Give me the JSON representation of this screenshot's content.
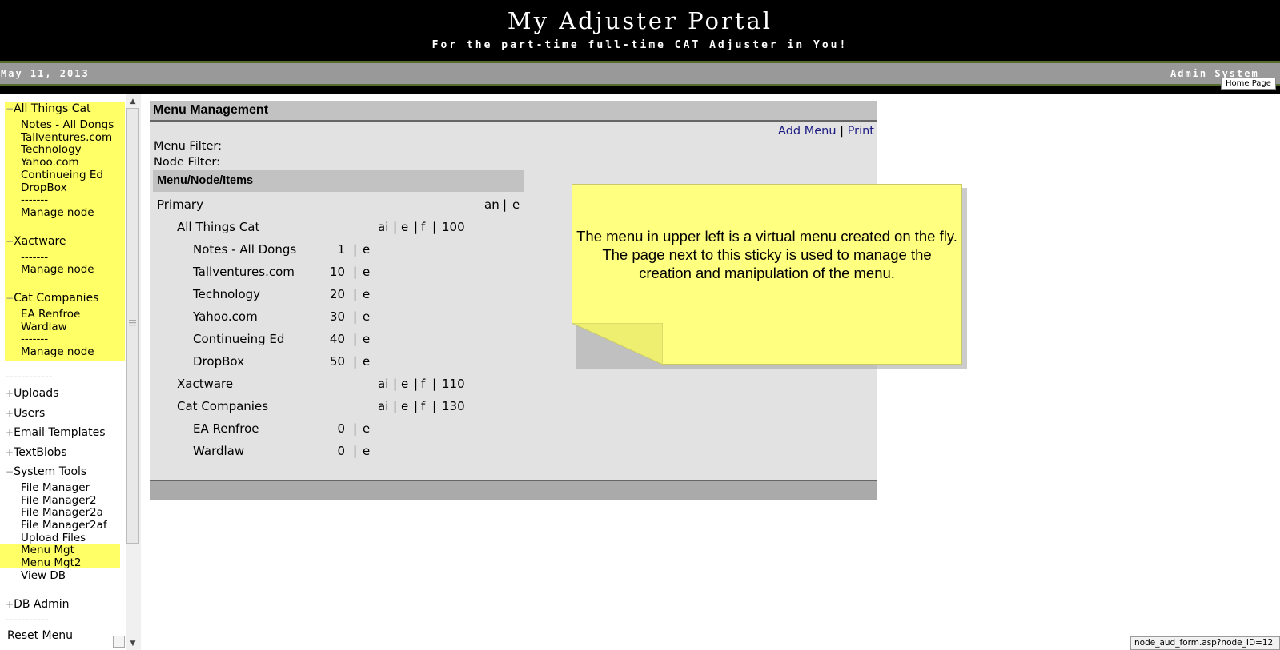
{
  "header": {
    "title": "My Adjuster Portal",
    "subtitle": "For the part-time full-time CAT Adjuster in You!",
    "date": "May 11, 2013",
    "admin_label": "Admin System",
    "home_tooltip": "Home Page"
  },
  "sidebar": {
    "group1_title": "All Things Cat",
    "group1_items": [
      "Notes - All Dongs",
      "Tallventures.com",
      "Technology",
      "Yahoo.com",
      "Continueing Ed",
      "DropBox",
      "-------",
      "Manage node"
    ],
    "group2_title": "Xactware",
    "group2_items": [
      "-------",
      "Manage node"
    ],
    "group3_title": "Cat Companies",
    "group3_items": [
      "EA Renfroe",
      "Wardlaw",
      "-------",
      "Manage node"
    ],
    "separator1": "------------",
    "uploads": "Uploads",
    "users": "Users",
    "email_templates": "Email Templates",
    "textblobs": "TextBlobs",
    "system_tools": "System Tools",
    "tools_items": [
      "File Manager",
      "File Manager2",
      "File Manager2a",
      "File Manager2af",
      "Upload Files",
      "Menu Mgt",
      "Menu Mgt2",
      "View DB"
    ],
    "db_admin": "DB Admin",
    "separator2": "-----------",
    "reset_menu": "Reset Menu",
    "plus": "+",
    "minus": "−"
  },
  "panel": {
    "title": "Menu Management",
    "add_menu": "Add Menu",
    "print": "Print",
    "pipe": "|",
    "menu_filter": "Menu Filter:",
    "node_filter": "Node Filter:",
    "table_header": "Menu/Node/Items",
    "primary": "Primary",
    "primary_an": "an",
    "primary_e": "e",
    "nodes": [
      {
        "name": "All Things Cat",
        "ai": "ai",
        "e": "e",
        "f": "f",
        "order": "100",
        "items": [
          {
            "name": "Notes - All Dongs",
            "order": "1",
            "e": "e"
          },
          {
            "name": "Tallventures.com",
            "order": "10",
            "e": "e"
          },
          {
            "name": "Technology",
            "order": "20",
            "e": "e"
          },
          {
            "name": "Yahoo.com",
            "order": "30",
            "e": "e"
          },
          {
            "name": "Continueing Ed",
            "order": "40",
            "e": "e"
          },
          {
            "name": "DropBox",
            "order": "50",
            "e": "e"
          }
        ]
      },
      {
        "name": "Xactware",
        "ai": "ai",
        "e": "e",
        "f": "f",
        "order": "110",
        "items": []
      },
      {
        "name": "Cat Companies",
        "ai": "ai",
        "e": "e",
        "f": "f",
        "order": "130",
        "items": [
          {
            "name": "EA Renfroe",
            "order": "0",
            "e": "e"
          },
          {
            "name": "Wardlaw",
            "order": "0",
            "e": "e"
          }
        ]
      }
    ]
  },
  "sticky": {
    "text": "The menu in upper left is a virtual menu created on the fly.  The page next to this sticky is used to manage the creation and manipulation of the menu."
  },
  "statusbar": {
    "url": "node_aud_form.asp?node_ID=12"
  },
  "colors": {
    "header_bg": "#000000",
    "date_bar": "#999999",
    "highlight": "#ffff66",
    "sticky": "#ffff80",
    "panel_bg": "#e2e2e2",
    "link": "#1a1a80"
  }
}
